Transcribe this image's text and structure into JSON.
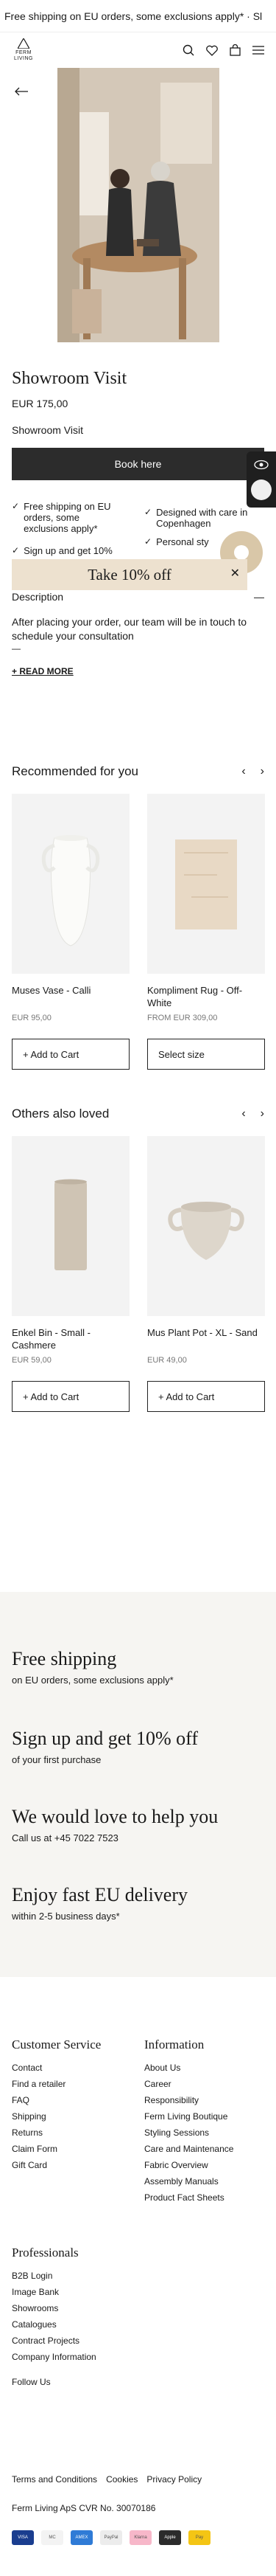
{
  "announcement": "Free shipping on EU orders, some exclusions apply* · Sl",
  "header": {
    "logo_line1": "FERM",
    "logo_line2": "LIVING",
    "icons": [
      "search-icon",
      "heart-icon",
      "bag-icon",
      "menu-icon"
    ]
  },
  "product": {
    "title": "Showroom Visit",
    "price": "EUR 175,00",
    "variant": "Showroom Visit",
    "cta": "Book here",
    "features": [
      "Free shipping on EU orders, some exclusions apply*",
      "Designed with care in Copenhagen",
      "Sign up and get 10%",
      "Personal sty"
    ],
    "description_label": "Description",
    "description": "After placing your order, our team will be in touch to schedule your consultation",
    "description_extra": "—",
    "read_more": "+ READ MORE"
  },
  "promo": {
    "text": "Take 10% off"
  },
  "recommended": {
    "title": "Recommended for you",
    "items": [
      {
        "name": "Muses Vase - Calli",
        "price": "EUR 95,00",
        "button": "+ Add to Cart"
      },
      {
        "name": "Kompliment Rug - Off-White",
        "price": "FROM EUR 309,00",
        "button": "Select size"
      }
    ]
  },
  "others": {
    "title": "Others also loved",
    "items": [
      {
        "name": "Enkel Bin - Small - Cashmere",
        "price": "EUR 59,00",
        "button": "+ Add to Cart"
      },
      {
        "name": "Mus Plant Pot - XL - Sand",
        "price": "EUR 49,00",
        "button": "+ Add to Cart"
      }
    ]
  },
  "benefits": [
    {
      "title": "Free shipping",
      "text": "on EU orders, some exclusions apply*"
    },
    {
      "title": "Sign up and get 10% off",
      "text": "of your first purchase"
    },
    {
      "title": "We would love to help you",
      "text": "Call us at +45 7022 7523"
    },
    {
      "title": "Enjoy fast EU delivery",
      "text": "within 2-5 business days*"
    }
  ],
  "footer": {
    "customer_service": {
      "title": "Customer Service",
      "links": [
        "Contact",
        "Find a retailer",
        "FAQ",
        "Shipping",
        "Returns",
        "Claim Form",
        "Gift Card"
      ]
    },
    "information": {
      "title": "Information",
      "links": [
        "About Us",
        "Career",
        "Responsibility",
        "Ferm Living Boutique",
        "Styling Sessions",
        "Care and Maintenance",
        "Fabric Overview",
        "Assembly Manuals",
        "Product Fact Sheets"
      ]
    },
    "professionals": {
      "title": "Professionals",
      "links": [
        "B2B Login",
        "Image Bank",
        "Showrooms",
        "Catalogues",
        "Contract Projects",
        "Company Information"
      ]
    },
    "follow": "Follow Us",
    "legal": [
      "Terms and Conditions",
      "Cookies",
      "Privacy Policy"
    ],
    "cvr": "Ferm Living ApS CVR No. 30070186",
    "payments": [
      "VISA",
      "MC",
      "AMEX",
      "PayPal",
      "Klarna",
      "Apple",
      "Pay"
    ]
  },
  "colors": {
    "button_dark": "#2c2c2c",
    "promo_bg": "#ede1cf",
    "benefits_bg": "#f6f5f2",
    "chat": "#d9c7a8"
  }
}
